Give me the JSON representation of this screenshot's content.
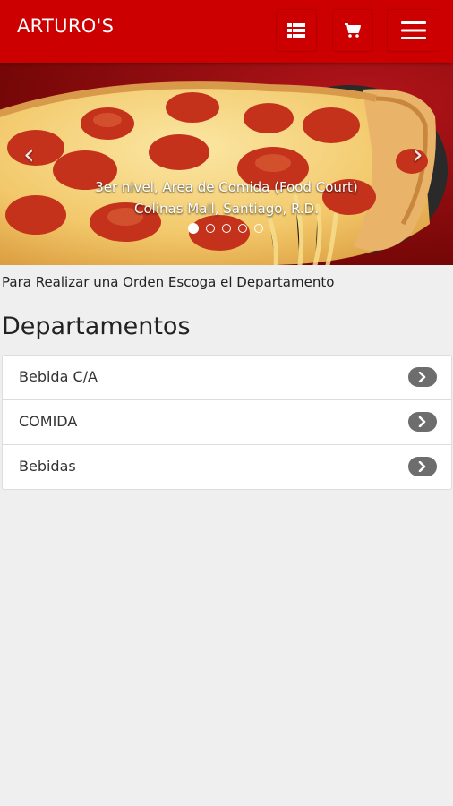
{
  "app_bar": {
    "title": "ARTURO'S",
    "icons": [
      "list-icon",
      "cart-icon",
      "hamburger-menu-icon"
    ],
    "background_color": "#cc0000"
  },
  "carousel": {
    "caption_line1": "3er nivel, Area de Comida (Food Court)",
    "caption_line2": "Colinas Mall, Santiago, R.D.",
    "prev_icon": "chevron-left-icon",
    "next_icon": "chevron-right-icon",
    "slide_count": 5,
    "active_slide": 1,
    "image": "pepperoni-pizza"
  },
  "instruction": "Para Realizar una Orden Escoga el Departamento",
  "section_title": "Departamentos",
  "departments": [
    {
      "label": "Bebida C/A"
    },
    {
      "label": "COMIDA"
    },
    {
      "label": "Bebidas"
    }
  ]
}
